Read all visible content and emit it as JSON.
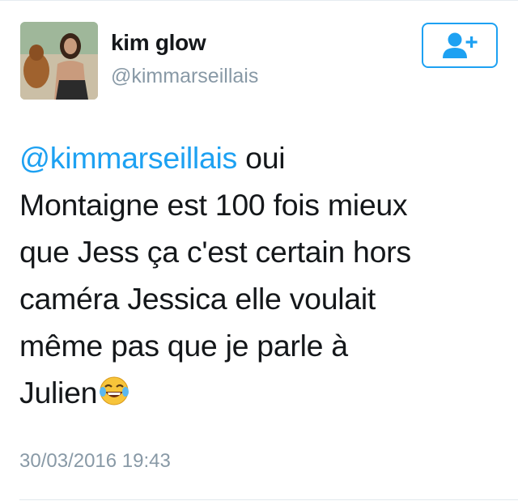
{
  "user": {
    "display_name": "kim glow",
    "handle": "@kimmarseillais",
    "avatar_icon": "profile-photo"
  },
  "follow_button": {
    "icon": "add-user-icon"
  },
  "tweet": {
    "mention": "@kimmarseillais",
    "lines": [
      " oui",
      "Montaigne est 100 fois mieux",
      "que Jess ça c'est certain hors",
      "caméra Jessica elle voulait",
      "même pas que je parle à",
      "Julien"
    ],
    "emoji": "face-with-tears-of-joy"
  },
  "timestamp": "30/03/2016 19:43",
  "colors": {
    "accent": "#1da1f2",
    "text": "#14171a",
    "muted": "#8899a6"
  }
}
